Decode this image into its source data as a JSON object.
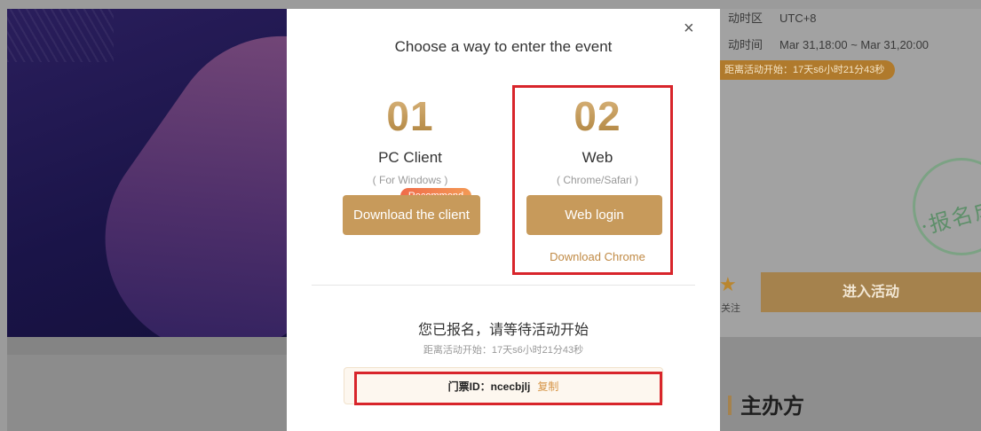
{
  "background": {
    "info": [
      {
        "label": "动时区",
        "value": "UTC+8"
      },
      {
        "label": "动时间",
        "value": "Mar 31,18:00 ~ Mar 31,20:00"
      }
    ],
    "countdown_pill": "距离活动开始：17天s6小时21分43秒",
    "stamp_text": "·报名成功",
    "follow_label": "关注",
    "enter_button": "进入活动",
    "organizer_heading": "主办方"
  },
  "modal": {
    "title": "Choose a way to enter the event",
    "close_icon": "×",
    "options": [
      {
        "number": "01",
        "title": "PC Client",
        "subtitle": "( For Windows )",
        "button": "Download the client",
        "badge": "Recommend"
      },
      {
        "number": "02",
        "title": "Web",
        "subtitle": "( Chrome/Safari )",
        "button": "Web login",
        "link": "Download Chrome"
      }
    ],
    "status": "您已报名，请等待活动开始",
    "countdown": "距离活动开始：17天s6小时21分43秒",
    "ticket": {
      "label": "门票ID：",
      "id": "ncecbjlj",
      "copy": "复制"
    }
  },
  "colors": {
    "accent": "#c79a5b",
    "highlight_box": "#d8252b",
    "badge": "#f06c4a"
  }
}
